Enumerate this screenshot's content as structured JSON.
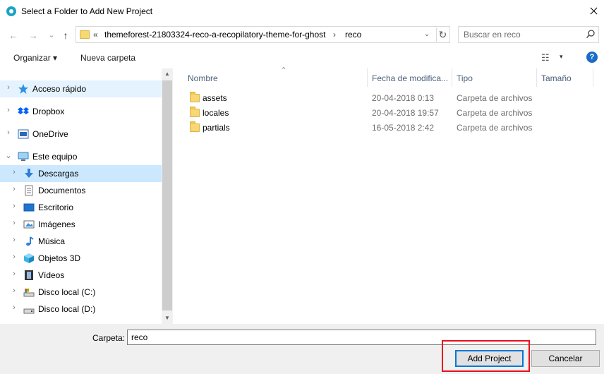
{
  "window": {
    "title": "Select a Folder to Add New Project",
    "close_glyph": "✕"
  },
  "nav_buttons": {
    "back": "←",
    "forward": "→",
    "recent": "⌄",
    "up": "↑"
  },
  "address": {
    "overflow": "«",
    "crumbs": [
      "themeforest-21803324-reco-a-recopilatory-theme-for-ghost",
      "reco"
    ],
    "separator": "›",
    "dropdown": "⌄",
    "refresh": "↻"
  },
  "search": {
    "placeholder": "Buscar en reco"
  },
  "toolbar": {
    "organizar": "Organizar ▾",
    "nueva_carpeta": "Nueva carpeta",
    "view_glyph": "☷",
    "view_dropdown": "▾",
    "help": "?"
  },
  "nav": {
    "items": [
      {
        "label": "Acceso rápido",
        "icon": "star-icon",
        "chev": "›",
        "level": 0,
        "state": "hover"
      },
      {
        "label": "Dropbox",
        "icon": "dropbox-icon",
        "chev": "›",
        "level": 0,
        "state": ""
      },
      {
        "label": "OneDrive",
        "icon": "onedrive-icon",
        "chev": "›",
        "level": 0,
        "state": ""
      },
      {
        "label": "Este equipo",
        "icon": "computer-icon",
        "chev": "⌄",
        "level": 0,
        "state": ""
      },
      {
        "label": "Descargas",
        "icon": "download-icon",
        "chev": "›",
        "level": 1,
        "state": "selected"
      },
      {
        "label": "Documentos",
        "icon": "document-icon",
        "chev": "›",
        "level": 1,
        "state": ""
      },
      {
        "label": "Escritorio",
        "icon": "desktop-icon",
        "chev": "›",
        "level": 1,
        "state": ""
      },
      {
        "label": "Imágenes",
        "icon": "pictures-icon",
        "chev": "›",
        "level": 1,
        "state": ""
      },
      {
        "label": "Música",
        "icon": "music-icon",
        "chev": "›",
        "level": 1,
        "state": ""
      },
      {
        "label": "Objetos 3D",
        "icon": "cube-icon",
        "chev": "›",
        "level": 1,
        "state": ""
      },
      {
        "label": "Vídeos",
        "icon": "video-icon",
        "chev": "›",
        "level": 1,
        "state": ""
      },
      {
        "label": "Disco local (C:)",
        "icon": "drive-c-icon",
        "chev": "›",
        "level": 1,
        "state": ""
      },
      {
        "label": "Disco local (D:)",
        "icon": "drive-d-icon",
        "chev": "›",
        "level": 1,
        "state": ""
      }
    ],
    "scroll_up": "▲",
    "scroll_down": "▼"
  },
  "files": {
    "columns": [
      "Nombre",
      "Fecha de modifica...",
      "Tipo",
      "Tamaño"
    ],
    "sort_glyph": "^",
    "rows": [
      {
        "name": "assets",
        "date": "20-04-2018 0:13",
        "type": "Carpeta de archivos"
      },
      {
        "name": "locales",
        "date": "20-04-2018 19:57",
        "type": "Carpeta de archivos"
      },
      {
        "name": "partials",
        "date": "16-05-2018 2:42",
        "type": "Carpeta de archivos"
      }
    ]
  },
  "footer": {
    "folder_label": "Carpeta:",
    "folder_value": "reco",
    "add_button": "Add Project",
    "cancel_button": "Cancelar"
  },
  "colors": {
    "selection": "#cce8ff",
    "hover": "#e5f3ff",
    "accent": "#0078d7",
    "highlight": "#e8101b",
    "folder": "#f8d775"
  }
}
